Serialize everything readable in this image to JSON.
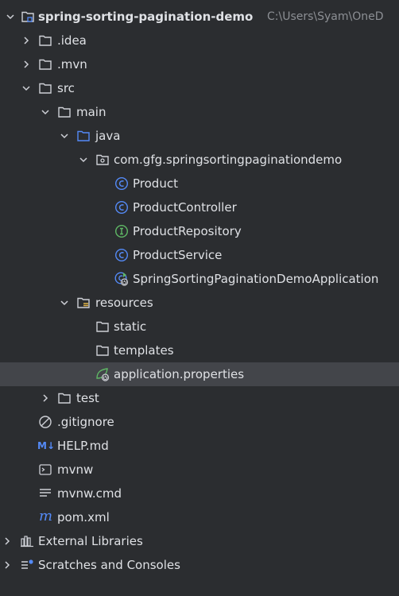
{
  "project": {
    "name": "spring-sorting-pagination-demo",
    "path": "C:\\Users\\Syam\\OneD"
  },
  "tree": {
    "idea": ".idea",
    "mvn": ".mvn",
    "src": "src",
    "main": "main",
    "java": "java",
    "package": "com.gfg.springsortingpaginationdemo",
    "product": "Product",
    "product_controller": "ProductController",
    "product_repository": "ProductRepository",
    "product_service": "ProductService",
    "application_class": "SpringSortingPaginationDemoApplication",
    "resources": "resources",
    "static": "static",
    "templates": "templates",
    "application_properties": "application.properties",
    "test": "test",
    "gitignore": ".gitignore",
    "help_md": "HELP.md",
    "mvnw": "mvnw",
    "mvnw_cmd": "mvnw.cmd",
    "pom_xml": "pom.xml",
    "external_libraries": "External Libraries",
    "scratches": "Scratches and Consoles"
  },
  "icon_glyphs": {
    "class": "C",
    "interface": "I",
    "markdown": "M↓",
    "maven": "m"
  },
  "colors": {
    "background": "#2b2d30",
    "selection": "#43454a",
    "text": "#dfe1e5",
    "muted": "#8c8f94",
    "class_icon": "#548af7",
    "interface_icon": "#5fb865",
    "spring_icon": "#5fb865",
    "folder_source": "#548af7"
  }
}
